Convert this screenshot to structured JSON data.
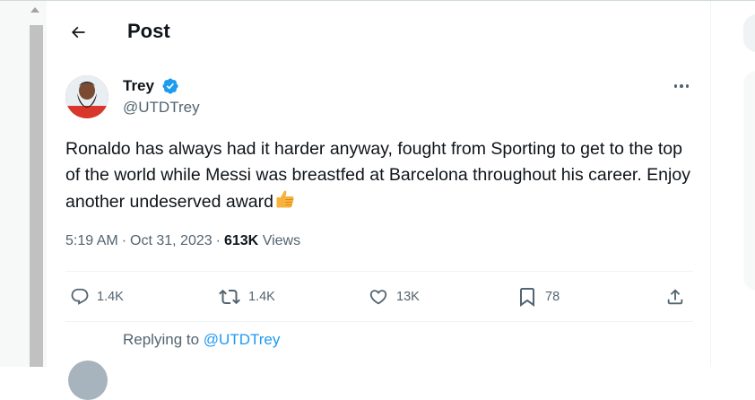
{
  "header": {
    "title": "Post",
    "back_icon": "arrow-left-icon"
  },
  "tweet": {
    "author": {
      "name": "Trey",
      "handle": "@UTDTrey",
      "verified": true,
      "verified_color": "#1d9bf0"
    },
    "text": "Ronaldo has always had it harder anyway, fought from Sporting to get to the top of the world while Messi was breastfed at Barcelona throughout his career. Enjoy another undeserved award",
    "text_emoji": "thumbs-up-icon",
    "time": "5:19 AM",
    "separator": "·",
    "date": "Oct 31, 2023",
    "views_count": "613K",
    "views_label": "Views",
    "actions": {
      "replies": "1.4K",
      "reposts": "1.4K",
      "likes": "13K",
      "bookmarks": "78"
    }
  },
  "reply_context": {
    "prefix": "Replying to",
    "handle": "@UTDTrey",
    "link_color": "#1d9bf0"
  }
}
